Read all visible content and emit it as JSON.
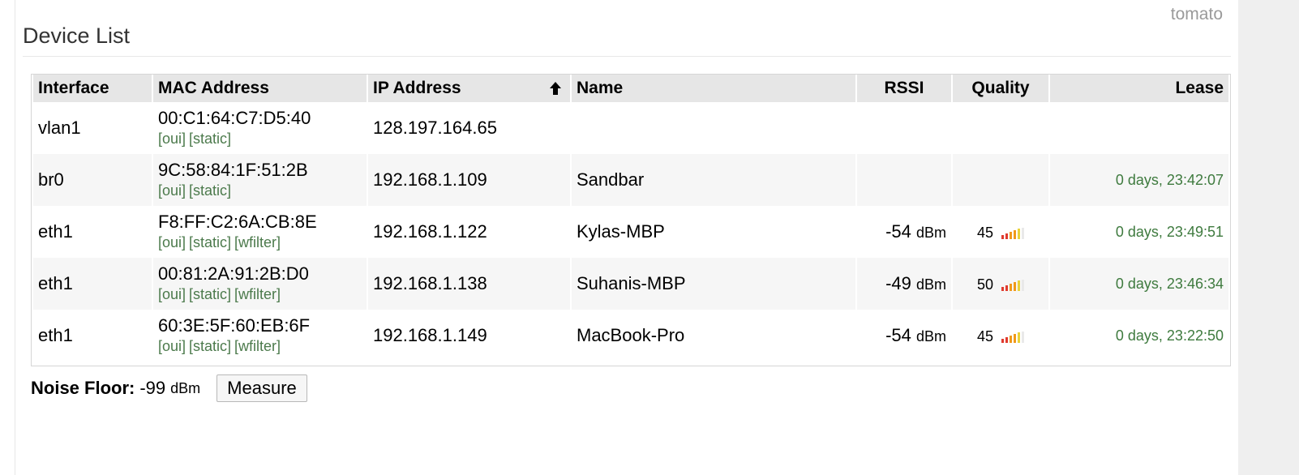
{
  "brand": "tomato",
  "section_title": "Device List",
  "table": {
    "columns": [
      "Interface",
      "MAC Address",
      "IP Address",
      "Name",
      "RSSI",
      "Quality",
      "Lease"
    ],
    "sort_indicator": "IP Address ascending",
    "rows": [
      {
        "interface": "vlan1",
        "mac": "00:C1:64:C7:D5:40",
        "links": [
          "[oui]",
          "[static]"
        ],
        "ip": "128.197.164.65",
        "name": "",
        "rssi_value": "",
        "rssi_unit": "",
        "quality": "",
        "quality_fraction": 0,
        "lease": ""
      },
      {
        "interface": "br0",
        "mac": "9C:58:84:1F:51:2B",
        "links": [
          "[oui]",
          "[static]"
        ],
        "ip": "192.168.1.109",
        "name": "Sandbar",
        "rssi_value": "",
        "rssi_unit": "",
        "quality": "",
        "quality_fraction": 0,
        "lease": "0 days, 23:42:07"
      },
      {
        "interface": "eth1",
        "mac": "F8:FF:C2:6A:CB:8E",
        "links": [
          "[oui]",
          "[static]",
          "[wfilter]"
        ],
        "ip": "192.168.1.122",
        "name": "Kylas-MBP",
        "rssi_value": "-54",
        "rssi_unit": "dBm",
        "quality": "45",
        "quality_fraction": 0.45,
        "lease": "0 days, 23:49:51"
      },
      {
        "interface": "eth1",
        "mac": "00:81:2A:91:2B:D0",
        "links": [
          "[oui]",
          "[static]",
          "[wfilter]"
        ],
        "ip": "192.168.1.138",
        "name": "Suhanis-MBP",
        "rssi_value": "-49",
        "rssi_unit": "dBm",
        "quality": "50",
        "quality_fraction": 0.5,
        "lease": "0 days, 23:46:34"
      },
      {
        "interface": "eth1",
        "mac": "60:3E:5F:60:EB:6F",
        "links": [
          "[oui]",
          "[static]",
          "[wfilter]"
        ],
        "ip": "192.168.1.149",
        "name": "MacBook-Pro",
        "rssi_value": "-54",
        "rssi_unit": "dBm",
        "quality": "45",
        "quality_fraction": 0.45,
        "lease": "0 days, 23:22:50"
      }
    ]
  },
  "noise": {
    "label": "Noise Floor:",
    "value": "-99",
    "unit": "dBm"
  },
  "measure_button": "Measure",
  "colors": {
    "link_green": "#4c7a4c",
    "lease_green": "#3e7a3e",
    "bar_red": "#e03a2e",
    "bar_orange": "#f09a1a",
    "bar_yellow": "#e8d23a",
    "bar_empty": "#e9e9e9"
  },
  "icons": {
    "sort": "arrow-up-icon",
    "quality": "signal-bars-icon"
  }
}
